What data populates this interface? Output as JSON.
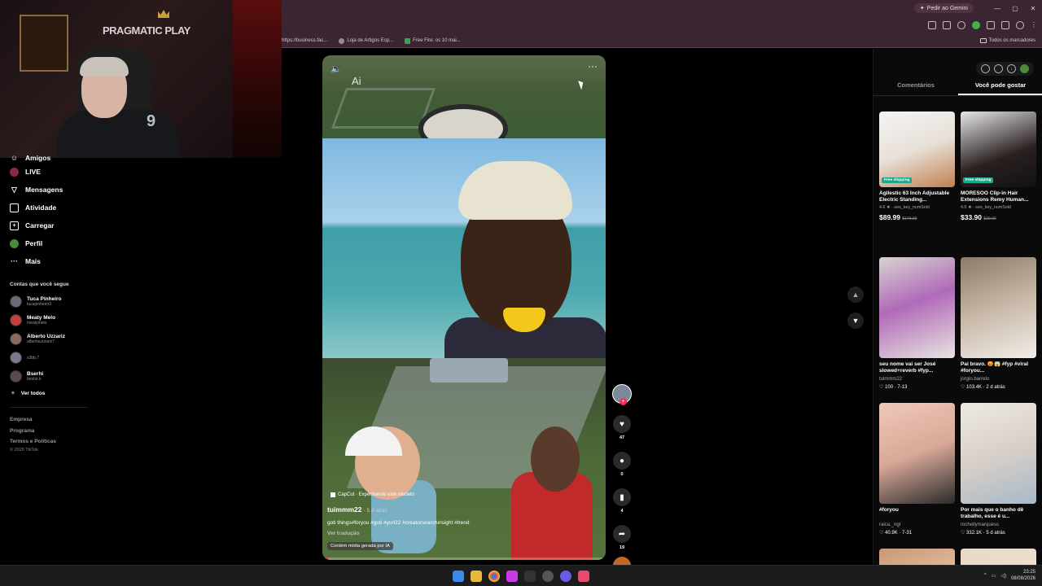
{
  "browser": {
    "gemini_label": "Pedir ao Gemini",
    "bookmarks": [
      "https://business.fac...",
      "Loja de Artigos Esp...",
      "Free Fire: os 10 mai..."
    ],
    "all_bookmarks": "Todos os marcadores"
  },
  "overlay": {
    "logo": "PRAGMATIC PLAY",
    "jersey": "9"
  },
  "sidebar": {
    "partial_item": "Amigos",
    "nav": [
      {
        "label": "LIVE",
        "icon": "live-icon"
      },
      {
        "label": "Mensagens",
        "icon": "messages-icon"
      },
      {
        "label": "Atividade",
        "icon": "activity-icon"
      },
      {
        "label": "Carregar",
        "icon": "upload-icon"
      },
      {
        "label": "Perfil",
        "icon": "profile-icon"
      },
      {
        "label": "Mais",
        "icon": "more-icon"
      }
    ],
    "following_title": "Contas que você segue",
    "following": [
      {
        "name": "Tuca Pinheiro",
        "handle": "tucapinheiro3"
      },
      {
        "name": "Meaty Melo",
        "handle": "meatymelo"
      },
      {
        "name": "Alberto Uzzariz",
        "handle": "albertouzzariz7"
      },
      {
        "name": "",
        "handle": "s3bb.7"
      },
      {
        "name": "Bserhi",
        "handle": "beshir.lr"
      }
    ],
    "see_all": "Ver todos",
    "footer": [
      "Empresa",
      "Programa",
      "Termos e Políticas"
    ],
    "copyright": "© 2026 TikTok"
  },
  "video": {
    "ai_badge": "Ai",
    "capcut": "CapCut · Experimente este modelo",
    "username": "tuimmm22",
    "posted": "· 5 d atrás",
    "description": "goti things#foryou #goti #yuri22 #creatorsearchinsight #trend",
    "translate": "Ver tradução",
    "ai_label": "Contém mídia gerada por IA",
    "progress": 0.02
  },
  "actions": {
    "likes": "47",
    "comments": "0",
    "saves": "4",
    "shares": "19"
  },
  "right_panel": {
    "tabs": [
      "Comentários",
      "Você pode gostar"
    ],
    "active_tab": 1,
    "cards": [
      {
        "title": "Agilestic 63 Inch Adjustable Electric Standing...",
        "rating": "4.6 ★ · seo_key_numSold",
        "price": "$89.99",
        "old": "$179.99",
        "ship": "Free shipping"
      },
      {
        "title": "MORESOO Clip-in Hair Extensions Remy Human...",
        "rating": "4.5 ★ · seo_key_numSold",
        "price": "$33.90",
        "old": "$39.00",
        "ship": "Free shipping"
      },
      {
        "title": "seu nome vai ser José slowed+reverb #fyp...",
        "user": "tuimmm22",
        "stats": "♡ 100 · 7-13"
      },
      {
        "title": "Pai bravo. 😡😱 #fyp #viral #foryou...",
        "user": "jorgin.barreto",
        "stats": "♡ 103.4K · 2 d atrás"
      },
      {
        "title": "#foryou",
        "user": "raica._ngr",
        "stats": "♡ 40.9K · 7-31"
      },
      {
        "title": "Por mais que o banho dê trabalho, esse é u...",
        "user": "rochellymarquess",
        "stats": "♡ 332.1K · 5 d atrás"
      }
    ]
  },
  "taskbar": {
    "time": "23:25",
    "date": "08/08/2026"
  }
}
